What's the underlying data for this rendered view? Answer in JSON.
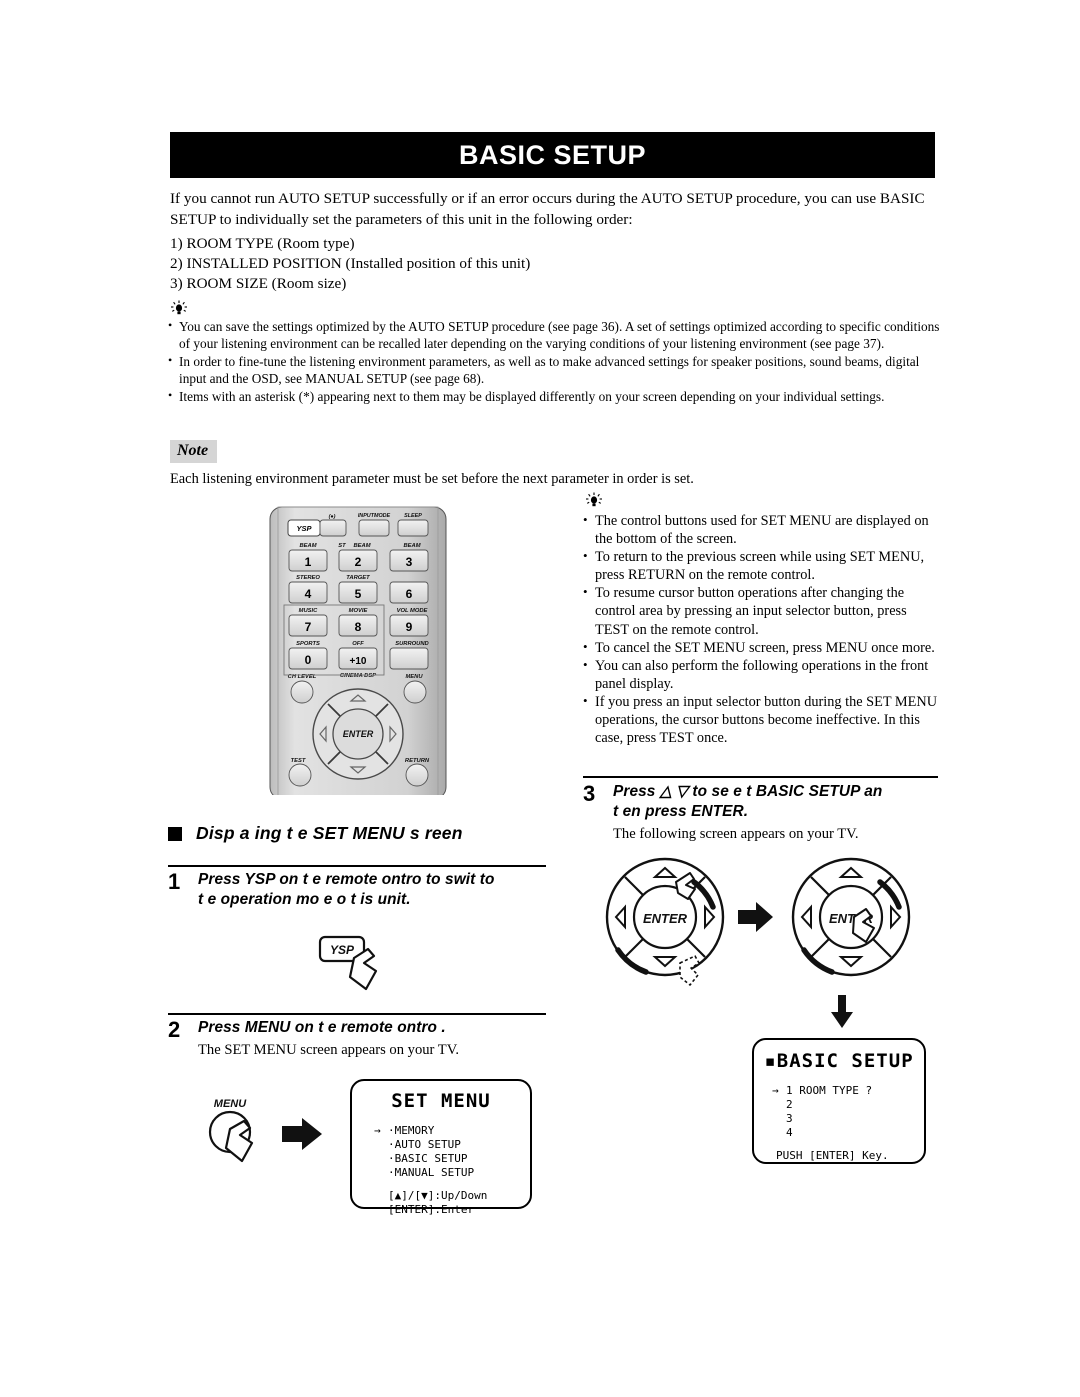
{
  "page": {
    "title": "BASIC SETUP"
  },
  "intro": {
    "paragraph": "If you cannot run AUTO SETUP successfully or if an error occurs during the AUTO SETUP procedure, you can use BASIC SETUP to individually set the parameters of this unit in the following order:",
    "order_items": [
      "1) ROOM TYPE (Room type)",
      "2) INSTALLED POSITION (Installed position of this unit)",
      "3) ROOM SIZE (Room size)"
    ]
  },
  "tips_main": {
    "icon": "tip-bulb-icon",
    "items": [
      "You can save the settings optimized by the AUTO SETUP procedure (see page 36). A set of settings optimized according to specific conditions of your listening environment can be recalled later depending on the varying conditions of your listening environment (see page 37).",
      "In order to fine-tune the listening environment parameters, as well as to make advanced settings for speaker positions, sound beams, digital input and the OSD, see MANUAL SETUP (see page 68).",
      "Items with an asterisk (*) appearing next to them may be displayed differently on your screen depending on your individual settings."
    ]
  },
  "note": {
    "badge": "Note",
    "text": "Each listening environment parameter must be set before the next parameter in order is set."
  },
  "remote": {
    "label": "remote-control-illustration",
    "top_row": [
      {
        "label": "YSP",
        "type": "labeled"
      },
      {
        "label": "",
        "top_label": "(●)",
        "type": "plain"
      },
      {
        "label": "",
        "top_label": "INPUTMODE",
        "type": "plain"
      },
      {
        "label": "",
        "top_label": "SLEEP",
        "type": "plain"
      }
    ],
    "keys": [
      {
        "top": "BEAM",
        "num": "1"
      },
      {
        "top": "ST  BEAM",
        "num": "2"
      },
      {
        "top": "BEAM",
        "num": "3"
      },
      {
        "top": "STEREO",
        "num": "4"
      },
      {
        "top": "TARGET",
        "num": "5"
      },
      {
        "top": "",
        "num": "6"
      },
      {
        "top": "MUSIC",
        "num": "7"
      },
      {
        "top": "MOVIE",
        "num": "8"
      },
      {
        "top": "VOL MODE",
        "num": "9"
      },
      {
        "top": "SPORTS",
        "num": "0"
      },
      {
        "top": "OFF",
        "num": "+10"
      },
      {
        "top": "SURROUND",
        "num": ""
      }
    ],
    "round_labels": {
      "ch_level": "CH LEVEL",
      "cinema_dsp": "CINEMA DSP",
      "menu": "MENU",
      "test": "TEST",
      "return": "RETURN",
      "enter": "ENTER"
    }
  },
  "tips_right": {
    "icon": "tip-bulb-icon",
    "items": [
      "The control buttons used for SET MENU are displayed on the bottom of the screen.",
      "To return to the previous screen while using SET MENU, press RETURN on the remote control.",
      "To resume cursor button operations after changing the control area by pressing an input selector button, press TEST on the remote control.",
      "To cancel the SET MENU screen, press MENU once more.",
      "You can also perform the following operations in the front panel display.",
      "If you press an input selector button during the SET MENU operations, the cursor buttons become ineffective. In this case, press TEST once."
    ]
  },
  "section": {
    "heading": "Disp a ing t e SET MENU s reen"
  },
  "steps": {
    "step1": {
      "number": "1",
      "head_line1": "Press YSP on t e remote  ontro  to swit    to",
      "head_line2": "t e operation mo  e o  t is unit.",
      "button_label": "YSP"
    },
    "step2": {
      "number": "2",
      "head": "Press MENU on t e remote  ontro .",
      "sub": "The SET MENU screen appears on your TV.",
      "button_label": "MENU"
    },
    "step3": {
      "number": "3",
      "head_line1": "Press △   ▽ to se e  t BASIC SETUP an",
      "head_line2": "t en press ENTER.",
      "sub": "The following screen appears on your TV."
    }
  },
  "osd_set_menu": {
    "title": "SET MENU",
    "cursor": "→",
    "items": [
      "·MEMORY",
      "·AUTO SETUP",
      "·BASIC SETUP",
      "·MANUAL SETUP"
    ],
    "footer": [
      "[▲]/[▼]:Up/Down",
      "[ENTER]:Enter"
    ]
  },
  "osd_basic_setup": {
    "title": "▪BASIC SETUP",
    "cursor": "→",
    "rows": [
      "1 ROOM TYPE ?",
      "2",
      "3",
      "4"
    ],
    "footer": "PUSH [ENTER] Key."
  },
  "cursor_pads": {
    "enter_label": "ENTER"
  },
  "colors": {
    "title_bar_bg": "#000000",
    "title_bar_fg": "#ffffff",
    "note_badge_bg": "#d5d5d5",
    "remote_body": "#d9d9d9",
    "remote_key": "#e8e8e8",
    "page_bg": "#ffffff"
  }
}
